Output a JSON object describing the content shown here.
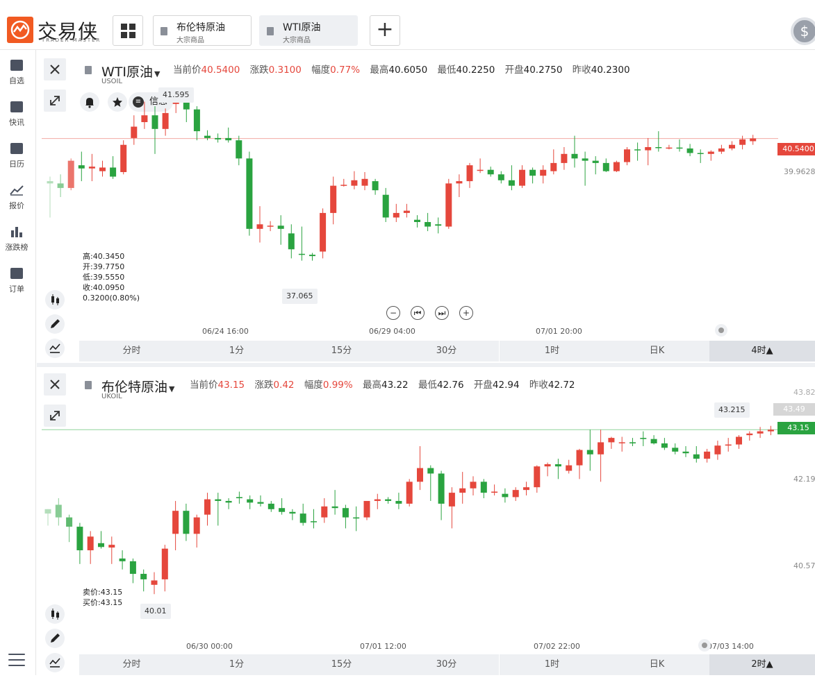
{
  "app": {
    "logo_text": "交易侠",
    "logo_sub": "TRADER MASTER",
    "tabs": [
      {
        "name": "布伦特原油",
        "sub": "大宗商品"
      },
      {
        "name": "WTI原油",
        "sub": "大宗商品"
      }
    ],
    "add_label": "+",
    "account_icon_label": "$"
  },
  "sidebar": {
    "items": [
      {
        "label": "自选",
        "icon": "bookmark-add-icon"
      },
      {
        "label": "快讯",
        "icon": "news-icon"
      },
      {
        "label": "日历",
        "icon": "calendar-icon"
      },
      {
        "label": "报价",
        "icon": "line-chart-icon"
      },
      {
        "label": "涨跌榜",
        "icon": "bar-chart-icon"
      },
      {
        "label": "订单",
        "icon": "clipboard-icon"
      }
    ]
  },
  "wti": {
    "title": "WTI原油",
    "symbol": "USOIL",
    "quotes": {
      "current_label": "当前价",
      "current": "40.5400",
      "change_label": "涨跌",
      "change": "0.3100",
      "range_label": "幅度",
      "range": "0.77%",
      "high_label": "最高",
      "high": "40.6050",
      "low_label": "最低",
      "low": "40.2250",
      "open_label": "开盘",
      "open": "40.2750",
      "prev_label": "昨收",
      "prev": "40.2300"
    },
    "info_label": "信息",
    "ohlc": {
      "high": "高:40.3450",
      "open": "开:39.7750",
      "low": "低:39.5550",
      "close": "收:40.0950",
      "change": "0.3200(0.80%)"
    },
    "max_tooltip": "41.595",
    "min_tooltip": "37.065",
    "price_tag": "40.5400",
    "side_price": "39.9628",
    "time_labels": [
      "06/24 16:00",
      "06/29 04:00",
      "07/01 20:00"
    ],
    "nav": [
      "−",
      "⏮",
      "⏭",
      "+"
    ],
    "periods": [
      "分时",
      "1分",
      "15分",
      "30分",
      "1时",
      "日K",
      "4时▲"
    ],
    "selected_period": 6
  },
  "brent": {
    "title": "布伦特原油",
    "symbol": "UKOIL",
    "quotes": {
      "current_label": "当前价",
      "current": "43.15",
      "change_label": "涨跌",
      "change": "0.42",
      "range_label": "幅度",
      "range": "0.99%",
      "high_label": "最高",
      "high": "43.22",
      "low_label": "最低",
      "low": "42.76",
      "open_label": "开盘",
      "open": "42.94",
      "prev_label": "昨收",
      "prev": "42.72"
    },
    "bid_ask": {
      "sell": "卖价:43.15",
      "buy": "买价:43.15"
    },
    "max_tooltip": "43.215",
    "min_tooltip": "40.01",
    "price_tag": "43.15",
    "hover_tag": "43.49",
    "axis_prices": [
      "43.82",
      "42.19",
      "40.57"
    ],
    "time_labels": [
      "06/30 00:00",
      "07/01 12:00",
      "07/02 22:00",
      "07/03 14:00"
    ],
    "periods": [
      "分时",
      "1分",
      "15分",
      "30分",
      "1时",
      "日K",
      "2时▲"
    ],
    "selected_period": 6
  },
  "colors": {
    "up": "#e5473c",
    "down": "#2aa340",
    "accent": "#f15a22"
  },
  "chart_data": [
    {
      "type": "candlestick",
      "title": "WTI原油",
      "interval": "4时",
      "ylim": [
        36.5,
        42.0
      ],
      "candles": [
        [
          39.6,
          39.7,
          38.8,
          39.55
        ],
        [
          39.55,
          39.75,
          39.25,
          39.45
        ],
        [
          39.45,
          40.1,
          39.4,
          40.05
        ],
        [
          39.95,
          40.25,
          39.6,
          39.88
        ],
        [
          39.88,
          40.2,
          39.6,
          39.92
        ],
        [
          39.82,
          40.05,
          39.7,
          39.9
        ],
        [
          39.9,
          40.15,
          39.65,
          39.7
        ],
        [
          39.8,
          40.5,
          39.75,
          40.4
        ],
        [
          40.55,
          41.05,
          40.4,
          40.8
        ],
        [
          40.9,
          41.35,
          40.75,
          41.05
        ],
        [
          41.05,
          41.25,
          40.2,
          40.75
        ],
        [
          40.75,
          41.2,
          40.6,
          41.1
        ],
        [
          41.3,
          41.55,
          41.1,
          41.5
        ],
        [
          41.5,
          41.6,
          40.9,
          41.18
        ],
        [
          41.18,
          41.25,
          40.5,
          40.7
        ],
        [
          40.6,
          40.72,
          40.5,
          40.55
        ],
        [
          40.55,
          40.65,
          40.45,
          40.52
        ],
        [
          40.55,
          40.78,
          40.45,
          40.5
        ],
        [
          40.5,
          40.6,
          39.95,
          40.1
        ],
        [
          40.1,
          40.25,
          38.4,
          38.55
        ],
        [
          38.55,
          39.05,
          38.25,
          38.65
        ],
        [
          38.6,
          38.72,
          38.5,
          38.62
        ],
        [
          38.62,
          38.85,
          38.2,
          38.55
        ],
        [
          38.45,
          38.65,
          37.9,
          38.1
        ],
        [
          38.0,
          38.6,
          37.85,
          37.98
        ],
        [
          37.98,
          38.02,
          37.85,
          37.95
        ],
        [
          38.05,
          39.0,
          37.9,
          38.9
        ],
        [
          38.9,
          39.7,
          38.65,
          39.5
        ],
        [
          39.5,
          39.65,
          39.48,
          39.52
        ],
        [
          39.5,
          39.82,
          39.42,
          39.62
        ],
        [
          39.5,
          39.8,
          39.4,
          39.65
        ],
        [
          39.6,
          39.65,
          39.3,
          39.4
        ],
        [
          39.3,
          39.45,
          38.7,
          38.8
        ],
        [
          38.8,
          39.1,
          38.7,
          38.9
        ],
        [
          38.9,
          39.1,
          38.8,
          38.95
        ],
        [
          38.75,
          38.85,
          38.58,
          38.7
        ],
        [
          38.7,
          38.9,
          38.5,
          38.6
        ],
        [
          38.65,
          38.8,
          38.45,
          38.62
        ],
        [
          38.6,
          39.65,
          38.55,
          39.55
        ],
        [
          39.55,
          39.75,
          39.25,
          39.6
        ],
        [
          39.6,
          40.0,
          39.45,
          39.95
        ],
        [
          39.85,
          40.1,
          39.78,
          39.85
        ],
        [
          39.85,
          39.92,
          39.7,
          39.75
        ],
        [
          39.75,
          39.82,
          39.55,
          39.62
        ],
        [
          39.62,
          39.95,
          39.4,
          39.5
        ],
        [
          39.5,
          39.95,
          39.45,
          39.85
        ],
        [
          39.85,
          39.9,
          39.55,
          39.72
        ],
        [
          39.72,
          39.95,
          39.55,
          39.85
        ],
        [
          39.82,
          40.3,
          39.75,
          40.0
        ],
        [
          40.0,
          40.35,
          39.85,
          40.2
        ],
        [
          40.2,
          40.6,
          39.9,
          40.1
        ],
        [
          40.1,
          40.25,
          39.5,
          40.05
        ],
        [
          40.05,
          40.15,
          39.75,
          40.0
        ],
        [
          40.0,
          40.1,
          39.8,
          39.82
        ],
        [
          39.82,
          40.05,
          39.8,
          40.02
        ],
        [
          40.02,
          40.35,
          39.95,
          40.3
        ],
        [
          40.3,
          40.45,
          40.05,
          40.28
        ],
        [
          40.28,
          40.55,
          39.95,
          40.35
        ],
        [
          40.35,
          40.7,
          40.25,
          40.33
        ],
        [
          40.33,
          40.4,
          40.3,
          40.34
        ],
        [
          40.34,
          40.52,
          40.25,
          40.32
        ],
        [
          40.32,
          40.42,
          40.15,
          40.22
        ],
        [
          40.22,
          40.3,
          40.0,
          40.2
        ],
        [
          40.2,
          40.28,
          40.05,
          40.25
        ],
        [
          40.25,
          40.4,
          40.2,
          40.32
        ],
        [
          40.32,
          40.48,
          40.28,
          40.4
        ],
        [
          40.4,
          40.6,
          40.3,
          40.52
        ],
        [
          40.48,
          40.62,
          40.4,
          40.54
        ]
      ]
    },
    {
      "type": "candlestick",
      "title": "布伦特原油",
      "interval": "2时",
      "ylim": [
        39.9,
        43.9
      ],
      "candles": [
        [
          41.7,
          41.7,
          41.4,
          41.62
        ],
        [
          41.78,
          41.9,
          41.4,
          41.55
        ],
        [
          41.55,
          41.6,
          41.1,
          41.38
        ],
        [
          41.38,
          41.45,
          40.7,
          40.95
        ],
        [
          40.95,
          41.3,
          40.7,
          41.2
        ],
        [
          41.08,
          41.3,
          40.98,
          41.01
        ],
        [
          41.0,
          41.2,
          40.7,
          41.05
        ],
        [
          40.8,
          40.95,
          40.6,
          40.75
        ],
        [
          40.75,
          40.8,
          40.35,
          40.52
        ],
        [
          40.52,
          40.6,
          40.2,
          40.42
        ],
        [
          40.32,
          40.55,
          40.15,
          40.4
        ],
        [
          40.42,
          41.05,
          40.2,
          40.98
        ],
        [
          41.25,
          41.85,
          40.95,
          41.67
        ],
        [
          41.67,
          41.8,
          41.12,
          41.25
        ],
        [
          41.25,
          41.6,
          41.0,
          41.55
        ],
        [
          41.6,
          42.0,
          41.4,
          41.88
        ],
        [
          41.88,
          42.0,
          41.4,
          41.85
        ],
        [
          41.85,
          41.9,
          41.7,
          41.82
        ],
        [
          41.92,
          42.02,
          41.8,
          41.9
        ],
        [
          41.88,
          41.95,
          41.7,
          41.82
        ],
        [
          41.83,
          41.95,
          41.75,
          41.8
        ],
        [
          41.8,
          41.85,
          41.65,
          41.7
        ],
        [
          41.72,
          41.9,
          41.6,
          41.65
        ],
        [
          41.65,
          41.7,
          41.5,
          41.62
        ],
        [
          41.62,
          41.8,
          41.4,
          41.45
        ],
        [
          41.48,
          41.7,
          41.35,
          41.47
        ],
        [
          41.55,
          41.9,
          41.45,
          41.75
        ],
        [
          41.75,
          42.05,
          41.6,
          41.72
        ],
        [
          41.72,
          41.78,
          41.35,
          41.55
        ],
        [
          41.55,
          41.75,
          41.3,
          41.53
        ],
        [
          41.55,
          41.85,
          41.5,
          41.85
        ],
        [
          41.85,
          41.98,
          41.7,
          41.88
        ],
        [
          41.88,
          41.92,
          41.8,
          41.85
        ],
        [
          41.85,
          42.0,
          41.7,
          41.8
        ],
        [
          41.8,
          42.25,
          41.75,
          42.2
        ],
        [
          42.2,
          42.85,
          42.05,
          42.45
        ],
        [
          42.45,
          42.5,
          41.85,
          42.35
        ],
        [
          42.35,
          42.4,
          41.5,
          41.8
        ],
        [
          41.75,
          42.1,
          41.35,
          42.0
        ],
        [
          42.0,
          42.38,
          41.8,
          42.08
        ],
        [
          42.08,
          42.3,
          41.95,
          42.2
        ],
        [
          42.2,
          42.25,
          41.9,
          42.0
        ],
        [
          42.0,
          42.15,
          41.95,
          42.02
        ],
        [
          41.98,
          42.08,
          41.82,
          41.92
        ],
        [
          41.92,
          42.1,
          41.85,
          42.05
        ],
        [
          42.05,
          42.2,
          41.95,
          42.1
        ],
        [
          42.1,
          42.5,
          42.0,
          42.48
        ],
        [
          42.48,
          42.55,
          42.3,
          42.52
        ],
        [
          42.52,
          42.62,
          42.25,
          42.48
        ],
        [
          42.4,
          42.6,
          42.35,
          42.5
        ],
        [
          42.5,
          42.8,
          42.25,
          42.78
        ],
        [
          42.78,
          43.15,
          42.4,
          42.7
        ],
        [
          42.7,
          43.15,
          42.2,
          42.92
        ],
        [
          42.92,
          43.02,
          42.8,
          43.0
        ],
        [
          42.92,
          43.02,
          42.75,
          42.92
        ],
        [
          42.92,
          43.0,
          42.85,
          42.9
        ],
        [
          43.0,
          43.12,
          42.85,
          42.98
        ],
        [
          42.98,
          43.05,
          42.88,
          42.9
        ],
        [
          42.9,
          43.0,
          42.78,
          42.82
        ],
        [
          42.82,
          42.9,
          42.7,
          42.75
        ],
        [
          42.75,
          42.85,
          42.65,
          42.72
        ],
        [
          42.7,
          42.85,
          42.55,
          42.62
        ],
        [
          42.62,
          42.8,
          42.55,
          42.75
        ],
        [
          42.7,
          42.95,
          42.6,
          42.86
        ],
        [
          42.86,
          43.0,
          42.75,
          42.88
        ],
        [
          42.88,
          43.05,
          42.8,
          43.02
        ],
        [
          43.05,
          43.12,
          42.95,
          43.08
        ],
        [
          43.08,
          43.2,
          43.0,
          43.12
        ],
        [
          43.12,
          43.22,
          43.05,
          43.15
        ]
      ]
    }
  ]
}
